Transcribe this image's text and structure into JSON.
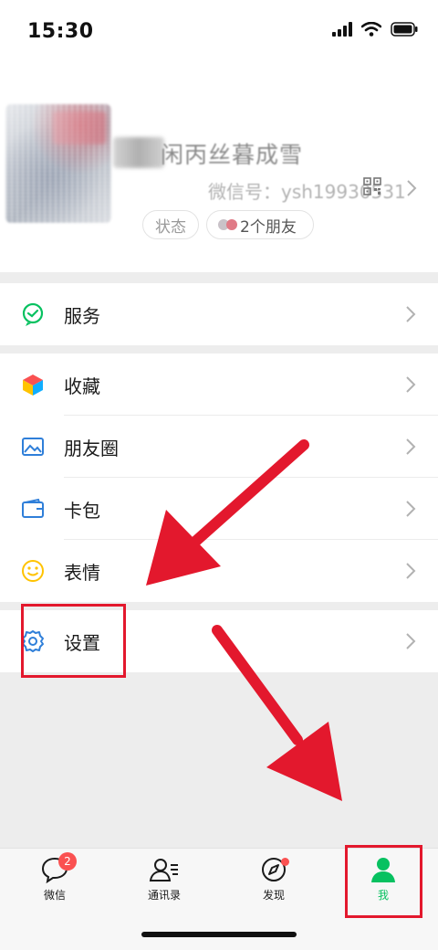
{
  "status_bar": {
    "time": "15:30"
  },
  "profile": {
    "nickname": "闲丙丝暮成雪",
    "wechat_id": "微信号：ysh19930531",
    "status_chip": "状态",
    "friends_chip": "2个朋友"
  },
  "menu": {
    "services": "服务",
    "favorites": "收藏",
    "moments": "朋友圈",
    "cards": "卡包",
    "stickers": "表情",
    "settings": "设置"
  },
  "tabs": [
    {
      "label": "微信",
      "badge": "2"
    },
    {
      "label": "通讯录"
    },
    {
      "label": "发现"
    },
    {
      "label": "我"
    }
  ],
  "colors": {
    "accent": "#07c160",
    "annotation": "#e3182d",
    "badge": "#fa5151"
  }
}
